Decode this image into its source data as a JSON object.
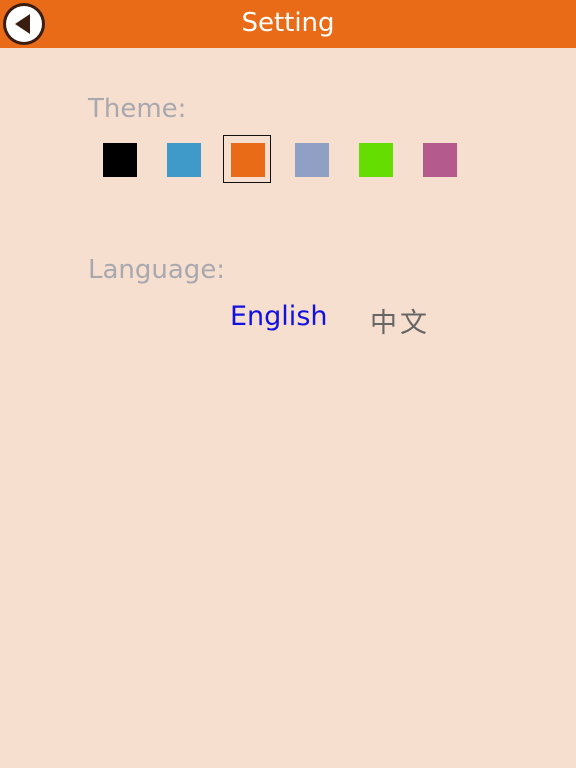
{
  "header": {
    "title": "Setting",
    "back_icon": "back-arrow-icon"
  },
  "theme": {
    "label": "Theme:",
    "selected_index": 2,
    "swatches": [
      {
        "name": "black",
        "color": "#000000"
      },
      {
        "name": "blue",
        "color": "#3f99c9"
      },
      {
        "name": "orange",
        "color": "#e96b17"
      },
      {
        "name": "slate",
        "color": "#8fa0c4"
      },
      {
        "name": "green",
        "color": "#66dd00"
      },
      {
        "name": "mauve",
        "color": "#b55a8d"
      }
    ]
  },
  "language": {
    "label": "Language:",
    "options": [
      "English",
      "中文"
    ],
    "selected": "English"
  },
  "colors": {
    "header_bg": "#e96b17",
    "page_bg": "#f7dfd0",
    "label_gray": "#a8a8ae",
    "selected_language": "#1010e0"
  }
}
